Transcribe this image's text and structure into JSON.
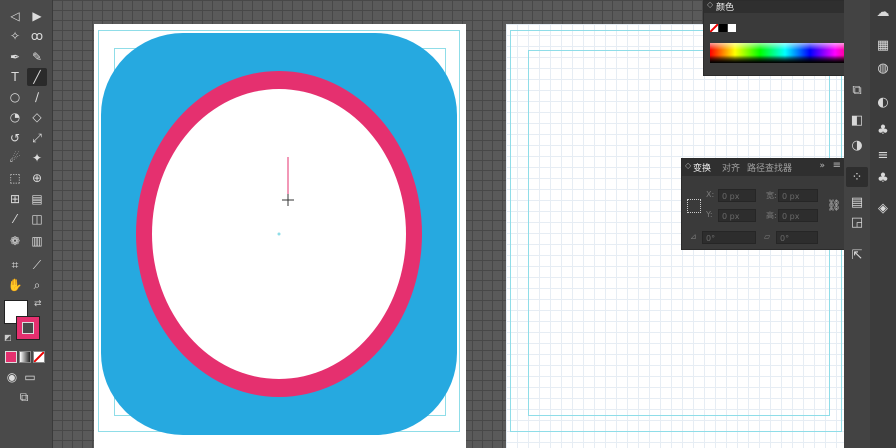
{
  "colors": {
    "workspace_bg": "#5a5a5a",
    "shape_fill": "#26a9e0",
    "ring_stroke": "#e5306f",
    "guide": "#8fdde8",
    "stroke_swatch": "#e5306f"
  },
  "toolbar": {
    "tools": [
      "direct-selection-tool",
      "selection-tool",
      "magic-wand-tool",
      "lasso-tool",
      "pen-tool",
      "curvature-tool",
      "type-tool",
      "line-segment-tool",
      "ellipse-tool",
      "paintbrush-tool",
      "shaper-tool",
      "eraser-tool",
      "rotate-tool",
      "scale-tool",
      "warp-tool",
      "puppet-warp-tool",
      "free-transform-tool",
      "shape-builder-tool",
      "perspective-grid-tool",
      "mesh-tool",
      "gradient-tool",
      "eyedropper-tool",
      "blend-tool",
      "symbol-sprayer-tool",
      "column-graph-tool",
      "artboard-tool",
      "slice-tool",
      "hand-tool",
      "zoom-tool"
    ],
    "fill_color": "#ffffff",
    "stroke_color": "#e5306f"
  },
  "color_panel": {
    "title": "颜色"
  },
  "transform_panel": {
    "tabs": [
      "变换",
      "对齐",
      "路径查找器"
    ],
    "fields": {
      "x_label": "X:",
      "x_value": "0 px",
      "w_label": "宽:",
      "w_value": "0 px",
      "y_label": "Y:",
      "y_value": "0 px",
      "h_label": "高:",
      "h_value": "0 px",
      "rotate_value": "0°",
      "shear_value": "0°"
    }
  },
  "dock": {
    "icons": [
      "color-guide-icon",
      "cc-libraries-icon",
      "properties-icon",
      "layers-icon",
      "stroke-icon",
      "gradient-icon",
      "transparency-icon",
      "transform-icon",
      "align-icon",
      "pathfinder-icon",
      "export-icon",
      "swatches-icon",
      "brushes-icon",
      "symbols-icon",
      "graphic-styles-icon",
      "appearance-icon"
    ]
  }
}
